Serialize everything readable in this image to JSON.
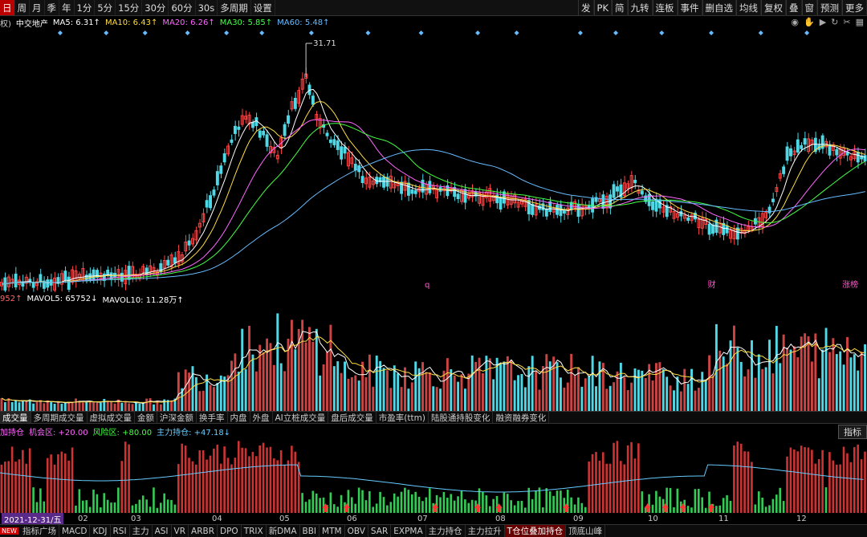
{
  "toolbar": {
    "periods": [
      "日",
      "周",
      "月",
      "季",
      "年",
      "1分",
      "5分",
      "15分",
      "30分",
      "60分",
      "30s",
      "多周期",
      "设置"
    ],
    "active_period": 0,
    "right_items": [
      "发",
      "PK",
      "简",
      "九转",
      "连板",
      "事件",
      "删自选",
      "均线",
      "复权",
      "叠",
      "窗",
      "预测",
      "更多"
    ]
  },
  "ma_legend": {
    "prefix": "权)",
    "stock_name": "中交地产",
    "items": [
      {
        "label": "MA5: 6.31↑",
        "color": "#ffffff"
      },
      {
        "label": "MA10: 6.43↑",
        "color": "#ffdd44"
      },
      {
        "label": "MA20: 6.26↑",
        "color": "#ff66ff"
      },
      {
        "label": "MA30: 5.85↑",
        "color": "#44ff44"
      },
      {
        "label": "MA60: 5.48↑",
        "color": "#66bbff"
      }
    ],
    "tool_icons": [
      "eye-icon",
      "hand-icon",
      "play-icon",
      "replay-icon",
      "scissors-icon",
      "grid-icon"
    ]
  },
  "price_panel": {
    "high_label": "31.71",
    "event_markers": [
      "q",
      "财",
      "涨榜"
    ],
    "colors": {
      "up": "#ff4444",
      "down": "#4fd8e6"
    }
  },
  "volume_legend": {
    "items": [
      {
        "label": "952↑",
        "color": "#ff6666"
      },
      {
        "label": "MAVOL5: 65752↓",
        "color": "#ffffff"
      },
      {
        "label": "MAVOL10: 11.28万↑",
        "color": "#ffffff"
      }
    ]
  },
  "volume_tabs": [
    "成交量",
    "多周期成交量",
    "虚拟成交量",
    "金额",
    "沪深金额",
    "换手率",
    "内盘",
    "外盘",
    "AI立桩成交量",
    "盘后成交量",
    "市盈率(ttm)",
    "陆股通持股变化",
    "融资融券变化"
  ],
  "indicator_legend": {
    "items": [
      {
        "label": "加持仓",
        "color": "#ff66ff"
      },
      {
        "label": "机会区: +20.00",
        "color": "#ff66ff"
      },
      {
        "label": "风险区: +80.00",
        "color": "#44ff44"
      },
      {
        "label": "主力持仓: +47.18↓",
        "color": "#66ccff"
      }
    ],
    "button_label": "指标"
  },
  "time_axis": {
    "current_date": "2021-12-31/五",
    "months": [
      "02",
      "03",
      "04",
      "05",
      "06",
      "07",
      "08",
      "09",
      "10",
      "11",
      "12"
    ]
  },
  "indicator_tabs": {
    "new_badge": "NEW",
    "items": [
      "指标广场",
      "MACD",
      "KDJ",
      "RSI",
      "主力",
      "ASI",
      "VR",
      "ARBR",
      "DPO",
      "TRIX",
      "新DMA",
      "BBI",
      "MTM",
      "OBV",
      "SAR",
      "EXPMA",
      "主力持仓",
      "主力拉升",
      "T仓位叠加持仓",
      "顶底山峰"
    ],
    "active": 18
  }
}
